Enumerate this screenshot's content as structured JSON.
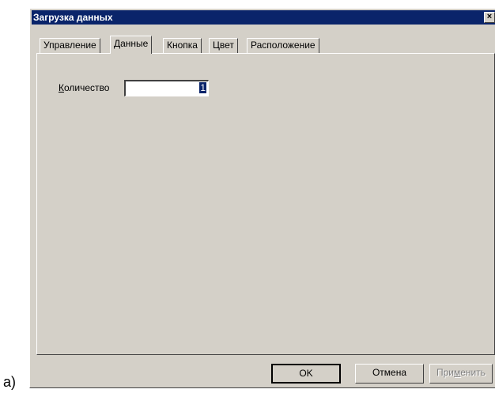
{
  "caption": "a)",
  "window": {
    "title": "Загрузка данных",
    "close_glyph": "×"
  },
  "tabs": [
    {
      "label": "Управление",
      "active": false
    },
    {
      "label": "Данные",
      "active": true
    },
    {
      "label": "Кнопка",
      "active": false
    },
    {
      "label": "Цвет",
      "active": false
    },
    {
      "label": "Расположение",
      "active": false
    }
  ],
  "panel": {
    "quantity_label_accel": "К",
    "quantity_label_rest": "оличество",
    "quantity_value": "1"
  },
  "buttons": {
    "ok": "OK",
    "cancel": "Отмена",
    "apply_pre": "При",
    "apply_accel": "м",
    "apply_post": "енить"
  }
}
